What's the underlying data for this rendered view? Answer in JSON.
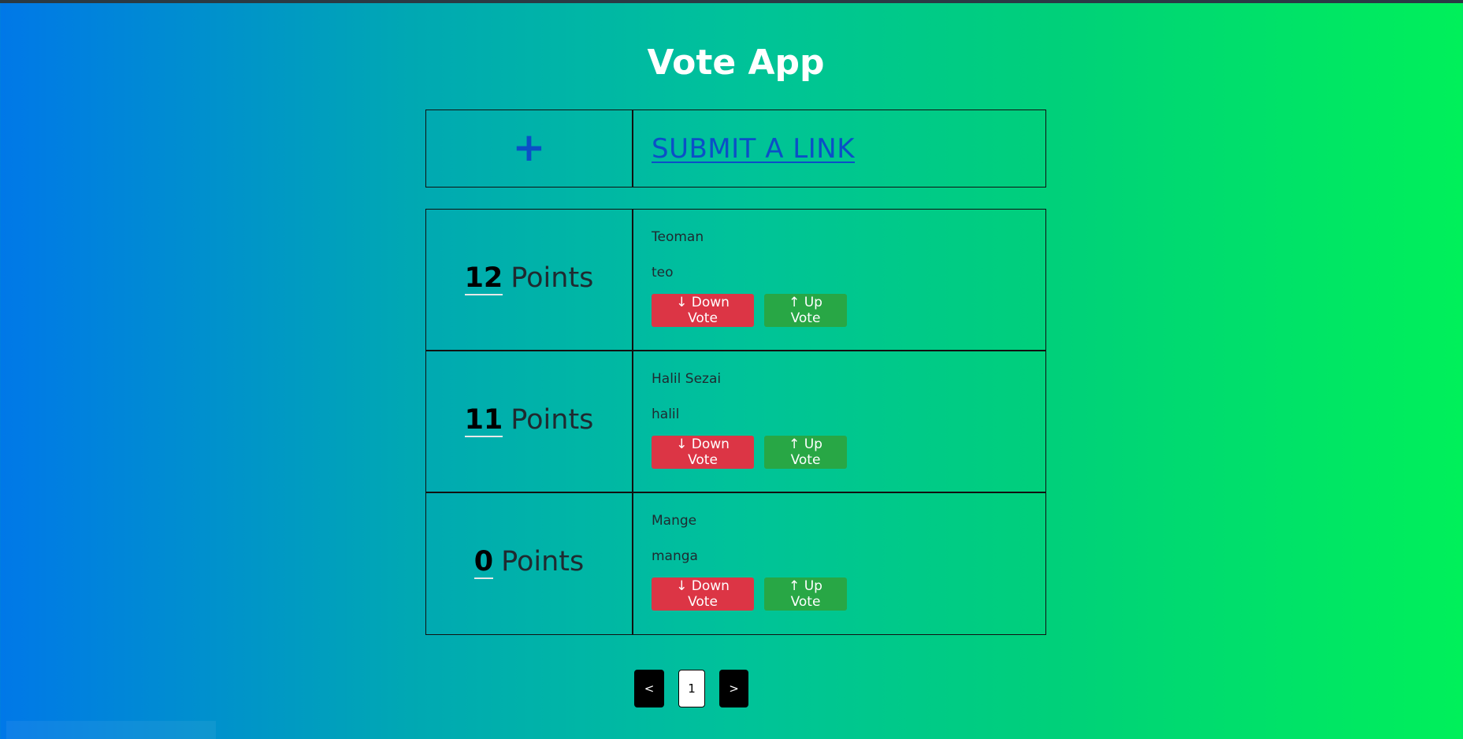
{
  "app": {
    "title": "Vote App"
  },
  "submit": {
    "icon": "plus-icon",
    "icon_glyph": "+",
    "label": "SUBMIT A LINK"
  },
  "links": [
    {
      "points": "12",
      "points_label": "Points",
      "name": "Teoman",
      "url": "teo",
      "down_label": "↓ Down Vote",
      "up_label": "↑ Up Vote"
    },
    {
      "points": "11",
      "points_label": "Points",
      "name": "Halil Sezai",
      "url": "halil",
      "down_label": "↓ Down Vote",
      "up_label": "↑ Up Vote"
    },
    {
      "points": "0",
      "points_label": "Points",
      "name": "Mange",
      "url": "manga",
      "down_label": "↓ Down Vote",
      "up_label": "↑ Up Vote"
    }
  ],
  "pagination": {
    "prev": "<",
    "current": "1",
    "next": ">"
  },
  "colors": {
    "down_vote": "#dc3545",
    "up_vote": "#28a745",
    "link": "#0b4fc7"
  }
}
